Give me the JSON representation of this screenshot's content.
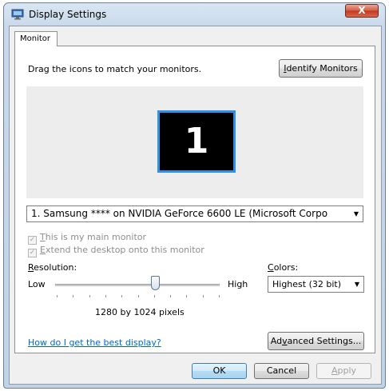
{
  "window": {
    "title": "Display Settings",
    "close_label": "X"
  },
  "tabs": [
    {
      "label": "Monitor"
    }
  ],
  "monitor_tab": {
    "instruction": "Drag the icons to match your monitors.",
    "identify_button": {
      "accel": "I",
      "rest": "dentify Monitors"
    },
    "monitor_number": "1",
    "monitor_select_value": "1. Samsung **** on NVIDIA GeForce 6600 LE (Microsoft Corpo",
    "main_monitor_checkbox": {
      "accel": "T",
      "rest": "his is my main monitor",
      "checked": true,
      "enabled": false
    },
    "extend_desktop_checkbox": {
      "accel": "E",
      "rest": "xtend the desktop onto this monitor",
      "checked": true,
      "enabled": false
    },
    "resolution": {
      "label_accel": "R",
      "label_rest": "esolution:",
      "low": "Low",
      "high": "High",
      "value_text": "1280 by 1024 pixels",
      "slider_position": 0.61
    },
    "colors": {
      "label_accel": "C",
      "label_rest": "olors:",
      "selected": "Highest (32 bit)"
    },
    "help_link": "How do I get the best display?",
    "advanced_button": {
      "pre": "Ad",
      "accel": "v",
      "rest": "anced Settings..."
    }
  },
  "dialog_buttons": {
    "ok": "OK",
    "cancel": "Cancel",
    "apply": {
      "accel": "A",
      "rest": "pply",
      "enabled": false
    }
  },
  "colors_theme": {
    "monitor_border": "#2f90e8",
    "link": "#0066cc",
    "close_button": "#c2361d"
  }
}
